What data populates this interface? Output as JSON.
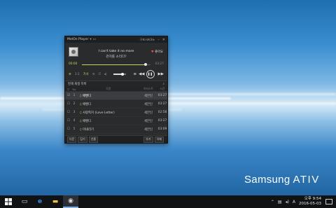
{
  "desktop": {
    "brand_prefix": "Samsung",
    "brand_name": "ATIV"
  },
  "player": {
    "app_title": "MelOn Player",
    "user_label": "구포시버3뉴",
    "now_playing": {
      "title": "I can't take it no more",
      "artist": "관지를 소리다?",
      "like_label": "좋아요"
    },
    "progress": {
      "elapsed": "00:00",
      "total": "03:27",
      "fraction": 0.93
    },
    "controls": {
      "mini_1": "1:1",
      "mini_2": "가사",
      "mini_3": "반복",
      "volume": 0.75
    },
    "playlist": {
      "title": "현재 재생 목록",
      "columns": {
        "no": "No",
        "title": "곡명",
        "artist": "아티스트",
        "time": "시간"
      },
      "rows": [
        {
          "no": "1",
          "title": "애벤디",
          "artist": "세븐틴",
          "time": "03:27"
        },
        {
          "no": "2",
          "title": "애벤디",
          "artist": "세븐틴",
          "time": "03:27"
        },
        {
          "no": "3",
          "title": "사랑쪽지 (Love Letter)",
          "artist": "세븐틴",
          "time": "02:58"
        },
        {
          "no": "4",
          "title": "애벤디",
          "artist": "세븐틴",
          "time": "03:27"
        },
        {
          "no": "5",
          "title": "미내리기",
          "artist": "세븐틴",
          "time": "03:09"
        }
      ]
    },
    "bottom": {
      "btn_1": "다운",
      "btn_2": "담기",
      "btn_3": "선물",
      "btn_add": "추가",
      "btn_del": "삭제"
    }
  },
  "taskbar": {
    "time": "오후 9:54",
    "date": "2016-05-03",
    "ime": "A"
  }
}
